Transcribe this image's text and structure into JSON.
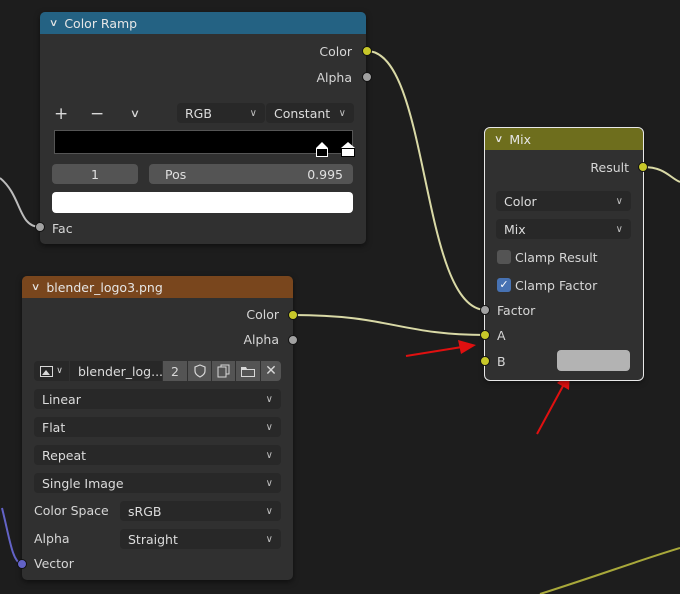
{
  "colors": {
    "background": "#1d1d1d",
    "node_body": "#303030",
    "header_converter": "#246283",
    "header_color": "#6e6e1d",
    "header_texture": "#79461d",
    "socket_color": "#c7c729",
    "socket_float": "#a1a1a1",
    "socket_vector": "#6363c7",
    "annotation_arrow": "#e01010"
  },
  "color_ramp": {
    "title": "Color Ramp",
    "outputs": [
      "Color",
      "Alpha"
    ],
    "add_icon": "+",
    "remove_icon": "−",
    "menu_icon": "chevron-down",
    "color_mode": "RGB",
    "interpolation": "Constant",
    "active_index": "1",
    "pos_label": "Pos",
    "pos_value": "0.995",
    "input": "Fac"
  },
  "mix": {
    "title": "Mix",
    "output": "Result",
    "data_type": "Color",
    "blend_type": "Mix",
    "clamp_result_label": "Clamp Result",
    "clamp_result": false,
    "clamp_factor_label": "Clamp Factor",
    "clamp_factor": true,
    "inputs": [
      "Factor",
      "A",
      "B"
    ]
  },
  "image_texture": {
    "title": "blender_logo3.png",
    "outputs": [
      "Color",
      "Alpha"
    ],
    "image_name": "blender_log...",
    "user_count": "2",
    "interpolation": "Linear",
    "projection": "Flat",
    "extension": "Repeat",
    "source": "Single Image",
    "color_space_label": "Color Space",
    "color_space": "sRGB",
    "alpha_label": "Alpha",
    "alpha_mode": "Straight",
    "input": "Vector"
  }
}
